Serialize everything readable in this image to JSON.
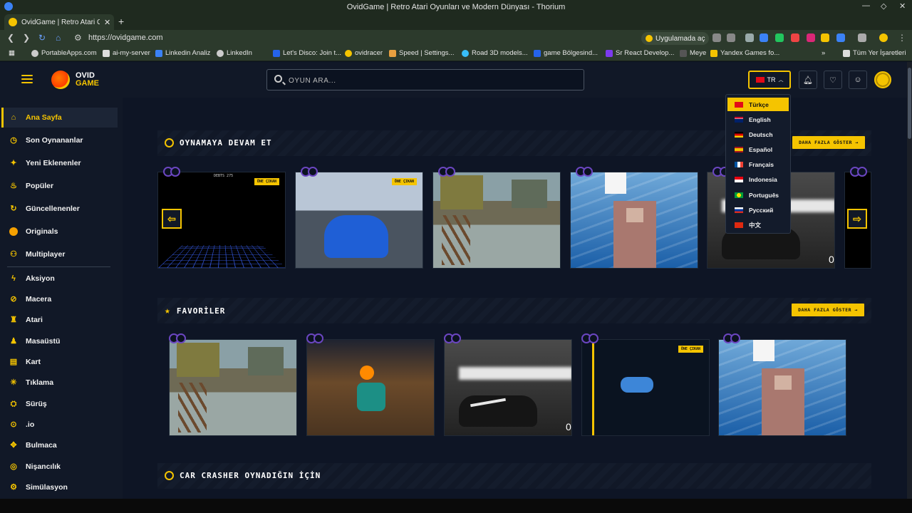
{
  "browser": {
    "window_title": "OvidGame | Retro Atari Oyunları ve Modern Dünyası - Thorium",
    "tab_label": "OvidGame | Retro Atari Oy",
    "url": "https://ovidgame.com",
    "app_button": "Uygulamada aç",
    "bookmarks": [
      "PortableApps.com",
      "ai-my-server",
      "Linkedin Analiz",
      "LinkedIn",
      "Let's Disco: Join t...",
      "ovidracer",
      "Speed | Settings...",
      "Road 3D models...",
      "game Bölgesind...",
      "Sr React Develop...",
      "Meye",
      "Yandex Games fo..."
    ],
    "bookmarks_more": "»",
    "bookmarks_folder": "Tüm Yer İşaretleri"
  },
  "header": {
    "logo_line1": "OVID",
    "logo_line2": "GAME",
    "search_placeholder": "OYUN ARA...",
    "lang_code": "TR"
  },
  "sidebar": {
    "items": [
      {
        "label": "Ana Sayfa",
        "icon": "home-icon"
      },
      {
        "label": "Son Oynananlar",
        "icon": "clock-icon"
      },
      {
        "label": "Yeni Eklenenler",
        "icon": "sparkle-icon"
      },
      {
        "label": "Popüler",
        "icon": "fire-icon"
      },
      {
        "label": "Güncellenenler",
        "icon": "refresh-icon"
      },
      {
        "label": "Originals",
        "icon": "logo-icon"
      },
      {
        "label": "Multiplayer",
        "icon": "users-icon"
      }
    ],
    "categories": [
      {
        "label": "Aksiyon",
        "icon": "bolt-icon"
      },
      {
        "label": "Macera",
        "icon": "compass-icon"
      },
      {
        "label": "Atari",
        "icon": "joystick-icon"
      },
      {
        "label": "Masaüstü",
        "icon": "pawn-icon"
      },
      {
        "label": "Kart",
        "icon": "card-icon"
      },
      {
        "label": "Tıklama",
        "icon": "cursor-icon"
      },
      {
        "label": "Sürüş",
        "icon": "wheel-icon"
      },
      {
        "label": ".io",
        "icon": "dot-icon"
      },
      {
        "label": "Bulmaca",
        "icon": "puzzle-icon"
      },
      {
        "label": "Nişancılık",
        "icon": "target-icon"
      },
      {
        "label": "Simülasyon",
        "icon": "sim-icon"
      }
    ]
  },
  "sections": {
    "continue": {
      "title": "OYNAMAYA DEVAM ET",
      "more": "DAHA FAZLA GÖSTER →"
    },
    "favorites": {
      "title": "FAVORİLER",
      "more": "DAHA FAZLA GÖSTER →"
    },
    "car_crasher": {
      "title": "CAR CRASHER OYNADIĞIN İÇİN"
    }
  },
  "card_tag": "ÖNE ÇIKAN",
  "overlay_texts": {
    "tron_score": "DEBTS 275",
    "zero": "0"
  },
  "language_menu": {
    "selected": "Türkçe",
    "items": [
      "Türkçe",
      "English",
      "Deutsch",
      "Español",
      "Français",
      "Indonesia",
      "Português",
      "Русский",
      "中文"
    ]
  },
  "colors": {
    "accent": "#f5c400",
    "bg": "#0e1525",
    "panel": "#111827"
  }
}
